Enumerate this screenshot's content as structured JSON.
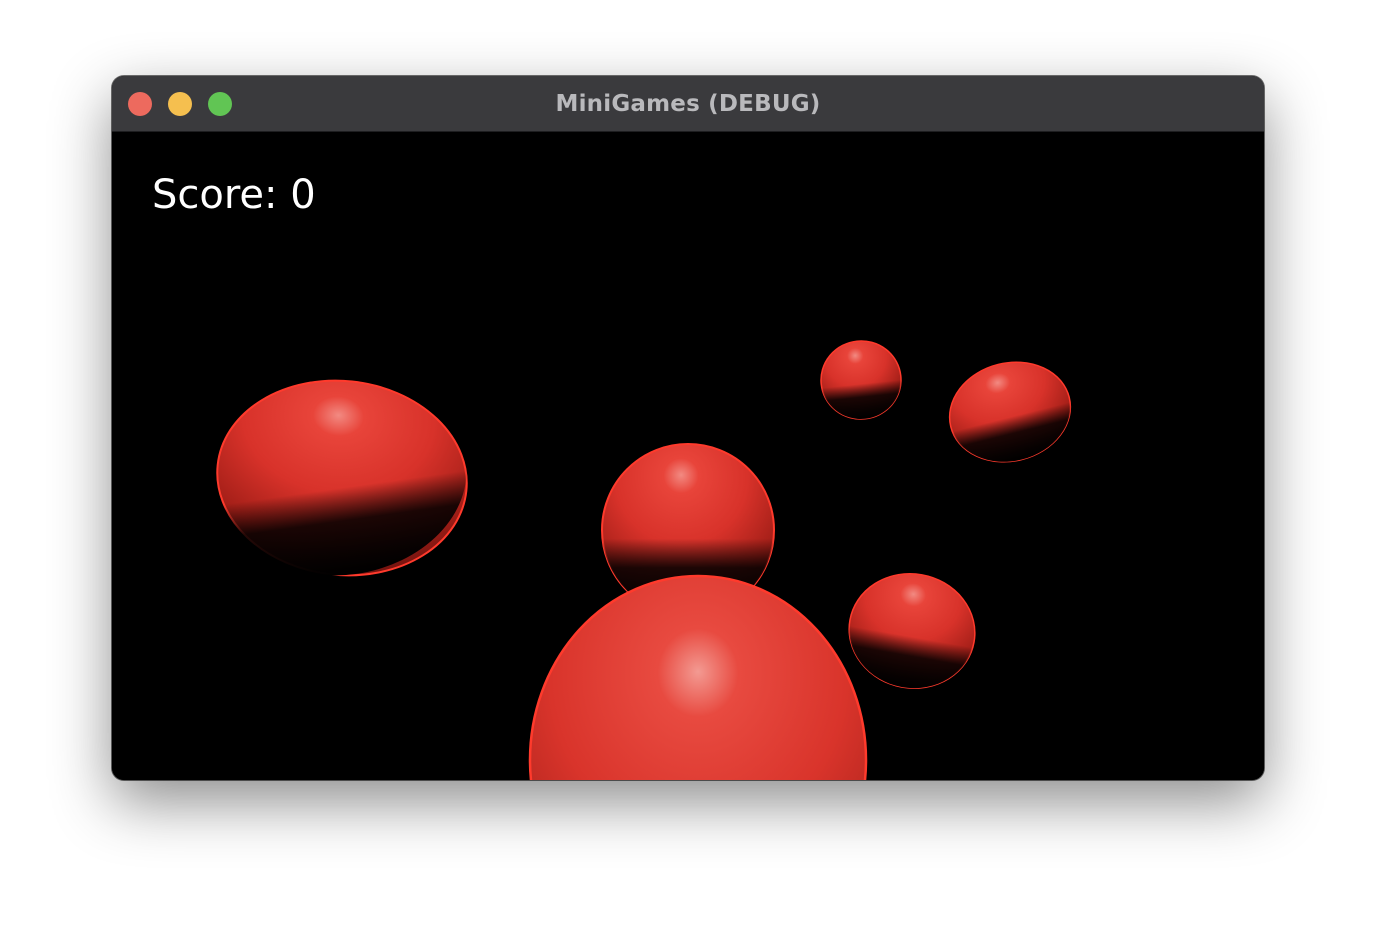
{
  "window": {
    "title": "MiniGames (DEBUG)",
    "controls": {
      "close_color": "#ed6a5e",
      "minimize_color": "#f5bf4f",
      "zoom_color": "#61c554"
    }
  },
  "hud": {
    "score_text": "Score: 0"
  },
  "scene": {
    "background": "#000000",
    "ball_color": "#e8362b",
    "ball_count": 6
  }
}
